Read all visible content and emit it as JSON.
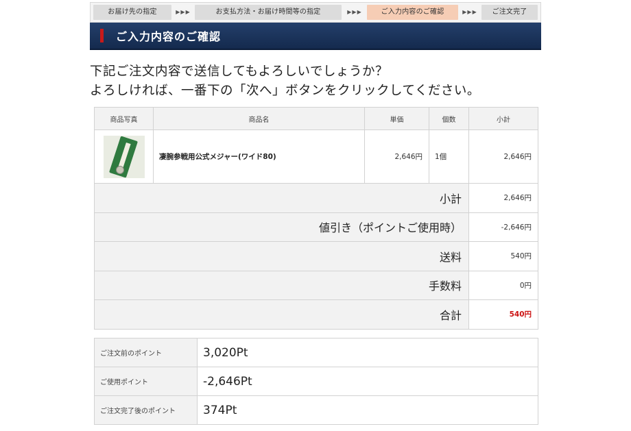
{
  "steps": [
    {
      "label": "お届け先の指定",
      "active": false
    },
    {
      "label": "お支払方法・お届け時間等の指定",
      "active": false
    },
    {
      "label": "ご入力内容のご確認",
      "active": true
    },
    {
      "label": "ご注文完了",
      "active": false
    }
  ],
  "step_arrows": "▶▶▶",
  "banner": {
    "title": "ご入力内容のご確認"
  },
  "message": {
    "line1": "下記ご注文内容で送信してもよろしいでしょうか？",
    "line2": "よろしければ、一番下の「次へ」ボタンをクリックしてください。"
  },
  "order_table": {
    "headers": {
      "photo": "商品写真",
      "name": "商品名",
      "price": "単価",
      "qty": "個数",
      "subtotal": "小計"
    },
    "items": [
      {
        "name": "凄腕参戦用公式メジャー(ワイド80)",
        "price": "2,646円",
        "qty": "1個",
        "subtotal": "2,646円"
      }
    ],
    "summary": {
      "subtotal_label": "小計",
      "subtotal_value": "2,646円",
      "discount_label": "値引き（ポイントご使用時）",
      "discount_value": "-2,646円",
      "shipping_label": "送料",
      "shipping_value": "540円",
      "fee_label": "手数料",
      "fee_value": "0円",
      "total_label": "合計",
      "total_value": "540円"
    }
  },
  "points": {
    "before_label": "ご注文前のポイント",
    "before_value": "3,020Pt",
    "used_label": "ご使用ポイント",
    "used_value": "-2,646Pt",
    "after_label": "ご注文完了後のポイント",
    "after_value": "374Pt"
  },
  "colors": {
    "banner": "#1c3560",
    "accent": "#c81a1a",
    "active_step": "#f6cdb5",
    "total": "#cc1111"
  }
}
